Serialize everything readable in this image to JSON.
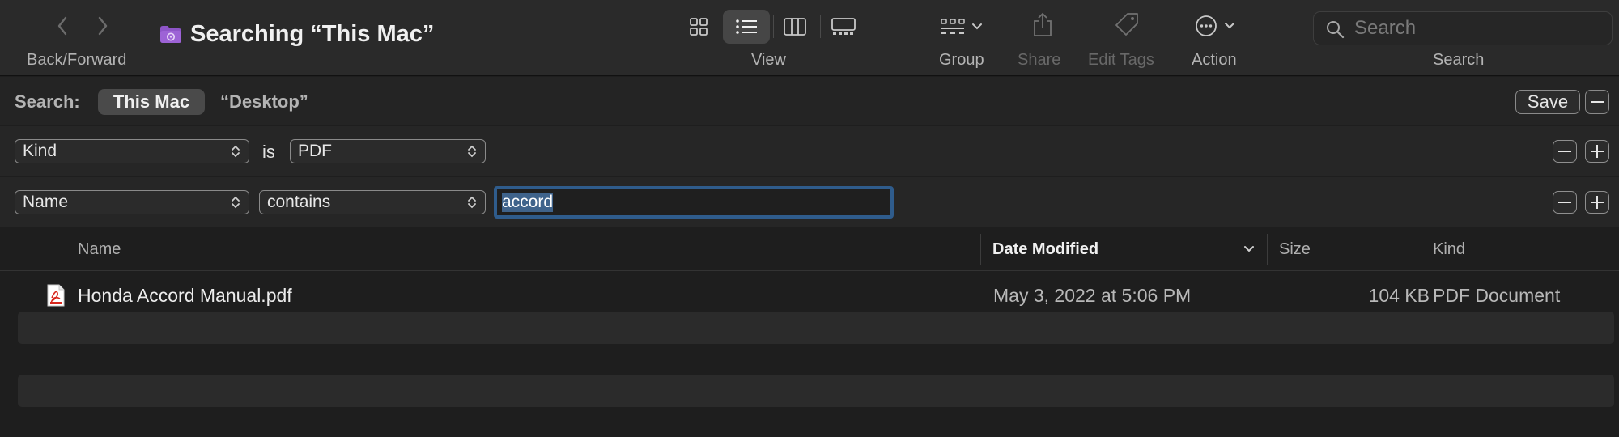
{
  "window": {
    "title": "Searching “This Mac”",
    "colors": {
      "folder_icon": "#8e55c8",
      "focus_ring": "#2f5c8c",
      "pdf_icon": "#d8281e"
    }
  },
  "toolbar": {
    "back_forward_label": "Back/Forward",
    "view_label": "View",
    "group_label": "Group",
    "share_label": "Share",
    "edit_tags_label": "Edit Tags",
    "action_label": "Action",
    "search_label": "Search",
    "search_placeholder": "Search",
    "view_modes": [
      "icon-view",
      "list-view",
      "column-view",
      "gallery-view"
    ],
    "selected_view": "list-view"
  },
  "scope": {
    "label": "Search:",
    "selected": "This Mac",
    "other": "“Desktop”",
    "save_label": "Save"
  },
  "criteria": [
    {
      "attribute": "Kind",
      "operator": "is",
      "value": "PDF"
    },
    {
      "attribute": "Name",
      "operator": "contains",
      "value": "accord"
    }
  ],
  "columns": {
    "name": "Name",
    "date_modified": "Date Modified",
    "size": "Size",
    "kind": "Kind",
    "sorted_by": "date_modified"
  },
  "files": [
    {
      "name": "Honda Accord Manual.pdf",
      "date_modified": "May 3, 2022 at 5:06 PM",
      "size": "104 KB",
      "kind": "PDF Document",
      "icon": "pdf-file-icon"
    }
  ]
}
